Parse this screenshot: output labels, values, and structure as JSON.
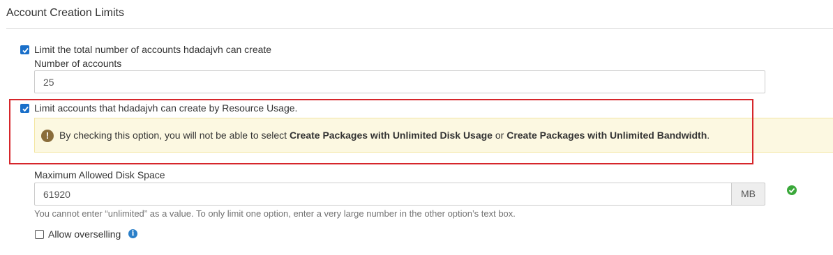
{
  "section": {
    "title": "Account Creation Limits"
  },
  "limit_total": {
    "checked": true,
    "label": "Limit the total number of accounts hdadajvh can create",
    "field_label": "Number of accounts",
    "value": "25"
  },
  "limit_resource": {
    "checked": true,
    "label": "Limit accounts that hdadajvh can create by Resource Usage.",
    "warning": {
      "icon": "exclamation-icon",
      "prefix": "By checking this option, you will not be able to select ",
      "bold1": "Create Packages with Unlimited Disk Usage",
      "middle": " or ",
      "bold2": "Create Packages with Unlimited Bandwidth",
      "suffix": "."
    }
  },
  "disk_space": {
    "label": "Maximum Allowed Disk Space",
    "value": "61920",
    "unit": "MB",
    "valid_icon": "check-circle-icon",
    "help": "You cannot enter “unlimited” as a value. To only limit one option, enter a very large number in the other option’s text box."
  },
  "overselling": {
    "checked": false,
    "label": "Allow overselling",
    "info_icon": "info-icon"
  },
  "colors": {
    "accent": "#1a6fc9",
    "warning_bg": "#fcf8e1",
    "highlight_border": "#d6262b",
    "success": "#3aa83a"
  }
}
